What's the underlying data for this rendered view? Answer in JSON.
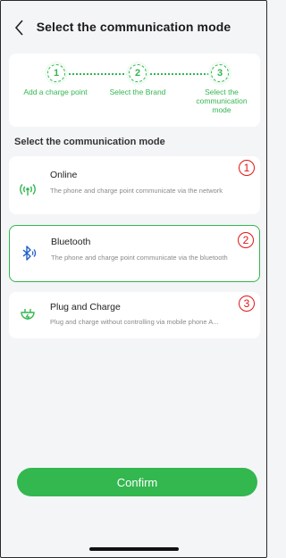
{
  "header": {
    "title": "Select the communication mode",
    "back_icon": "chevron-left-icon"
  },
  "steps": [
    {
      "number": "1",
      "label": "Add a charge point"
    },
    {
      "number": "2",
      "label": "Select the Brand"
    },
    {
      "number": "3",
      "label": "Select the communication mode"
    }
  ],
  "section_title": "Select the communication mode",
  "options": [
    {
      "title": "Online",
      "description": "The phone and charge point communicate via the network",
      "icon": "wireless-signal-icon",
      "marker": "1",
      "selected": false
    },
    {
      "title": "Bluetooth",
      "description": "The phone and charge point communicate via the bluetooth",
      "icon": "bluetooth-icon",
      "marker": "2",
      "selected": true
    },
    {
      "title": "Plug and Charge",
      "description": "Plug and charge without controlling via mobile phone A...",
      "icon": "plug-icon",
      "marker": "3",
      "selected": false
    }
  ],
  "confirm_label": "Confirm",
  "colors": {
    "accent": "#33b651",
    "marker": "#e31414",
    "background": "#f4f5f7"
  }
}
